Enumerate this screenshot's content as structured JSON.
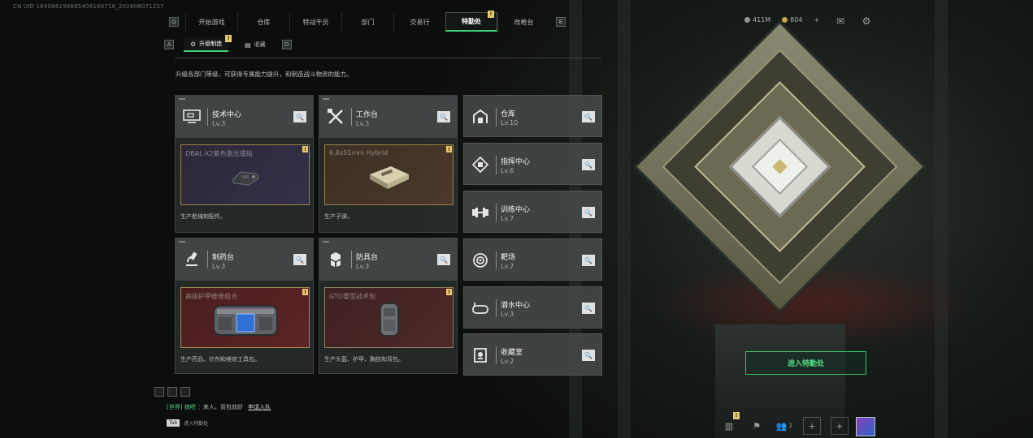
{
  "uid": "CN UID 184086198885408169718_202608071257",
  "nav": {
    "left_key": "Q",
    "right_key": "E",
    "tabs": [
      "开始游戏",
      "仓库",
      "特战干员",
      "部门",
      "交易行",
      "特勤处",
      "改枪台"
    ],
    "active": "特勤处",
    "badge": "!"
  },
  "currency": {
    "silver": "411M",
    "gold": "804"
  },
  "subnav": {
    "left_key": "A",
    "right_key": "D",
    "tabs": [
      "升级制造",
      "收藏"
    ],
    "active": "升级制造",
    "badge": "!"
  },
  "description": "升级各部门等级，可获得专属能力提升，和制造战斗物资的能力。",
  "workshops": [
    {
      "name": "技术中心",
      "level": "Lv.3",
      "icon": "monitor-icon",
      "product": "DBAL-X2紫色激光镭指",
      "product_desc": "生产枪械和配件。",
      "theme": "purple",
      "badge": "!"
    },
    {
      "name": "工作台",
      "level": "Lv.3",
      "icon": "tools-icon",
      "product": "6.8x51mm Hybrid",
      "product_desc": "生产子弹。",
      "theme": "brown",
      "badge": "!"
    },
    {
      "name": "制药台",
      "level": "Lv.3",
      "icon": "microscope-icon",
      "product": "高级护甲维修组合",
      "product_desc": "生产药品、针剂和维修工具包。",
      "theme": "red",
      "badge": "!"
    },
    {
      "name": "防具台",
      "level": "Lv.3",
      "icon": "armor-icon",
      "product": "GTO重型战术包",
      "product_desc": "生产头盔、护甲、胸挂和背包。",
      "theme": "red2",
      "badge": "!"
    }
  ],
  "departments": [
    {
      "name": "仓库",
      "level": "Lv.10",
      "icon": "warehouse-icon"
    },
    {
      "name": "指挥中心",
      "level": "Lv.6",
      "icon": "chip-icon"
    },
    {
      "name": "训练中心",
      "level": "Lv.7",
      "icon": "dumbbell-icon"
    },
    {
      "name": "靶场",
      "level": "Lv.7",
      "icon": "target-icon"
    },
    {
      "name": "潜水中心",
      "level": "Lv.3",
      "icon": "diving-icon"
    },
    {
      "name": "收藏室",
      "level": "Lv.2",
      "icon": "trophy-icon"
    }
  ],
  "enter_button": "进入特勤处",
  "chat": {
    "channel": "[世界]",
    "sender": "狼吧",
    "message": "：来人，背包就好",
    "link": "申请入队"
  },
  "tab_hint": {
    "key": "Tab",
    "label": "进入特勤处"
  },
  "bottom_icons": {
    "friends_count": "2"
  },
  "colors": {
    "accent": "#3fd27a",
    "badge": "#e9c86a",
    "panel": "#424846"
  }
}
